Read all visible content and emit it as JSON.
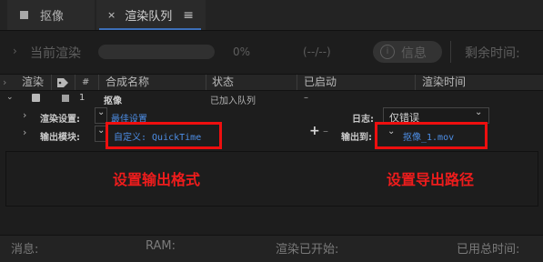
{
  "tabs": [
    {
      "label": "抠像"
    },
    {
      "close": "×",
      "label": "渲染队列",
      "menu": "≡"
    }
  ],
  "progress": {
    "label": "当前渲染",
    "percent": "0%",
    "range": "(--/--)",
    "info_icon": "i",
    "info_label": "信息",
    "remaining_label": "剩余时间:"
  },
  "header": {
    "render": "渲染",
    "num": "#",
    "comp_name": "合成名称",
    "status": "状态",
    "started": "已启动",
    "render_time": "渲染时间"
  },
  "row": {
    "number": "1",
    "comp_name": "抠像",
    "status": "已加入队列",
    "started": "–"
  },
  "render_settings": {
    "label": "渲染设置:",
    "value": "最佳设置",
    "log_label": "日志:",
    "log_value": "仅错误"
  },
  "output_module": {
    "label": "输出模块:",
    "value": "自定义: QuickTime",
    "add": "+",
    "remove": "–",
    "output_to_label": "输出到:",
    "output_to_value": "抠像_1.mov"
  },
  "annotations": {
    "left": "设置输出格式",
    "right": "设置导出路径",
    "color": "#ee1c1c"
  },
  "status_bar": {
    "message": "消息:",
    "ram": "RAM:",
    "render_started": "渲染已开始:",
    "total_time": "已用总时间:"
  },
  "colors": {
    "accent": "#3d6fb8",
    "link": "#4d8ee6",
    "background": "#1d1d1d"
  }
}
